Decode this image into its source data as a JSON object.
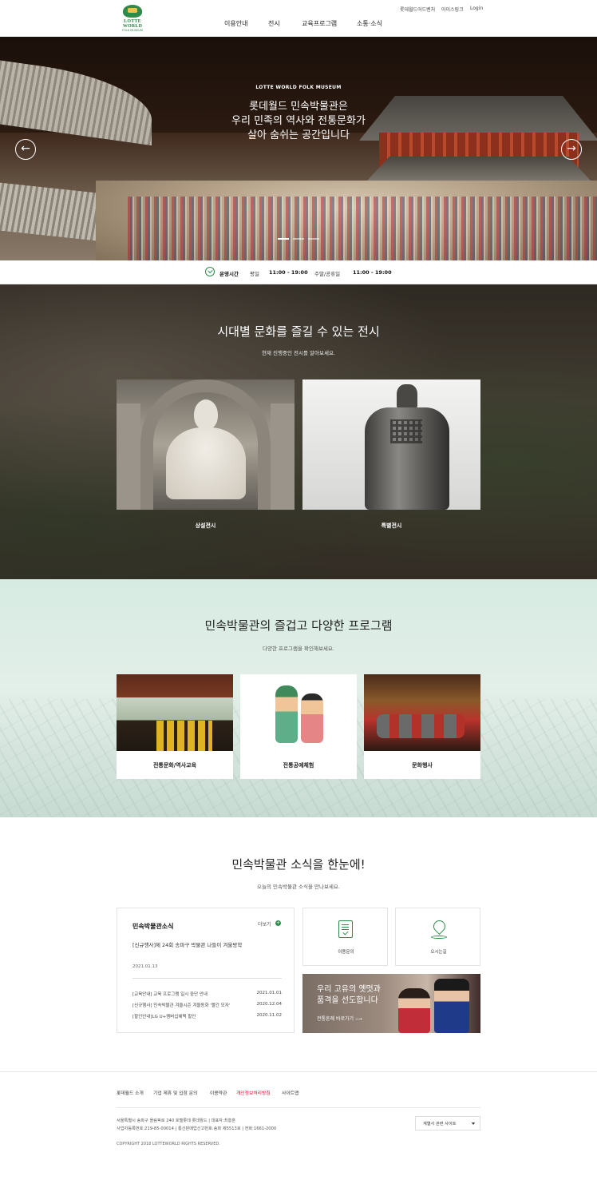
{
  "header": {
    "logo_text": "LOTTE WORLD",
    "logo_sub": "FOLK MUSEUM",
    "nav": [
      "이용안내",
      "전시",
      "교육프로그램",
      "소통·소식"
    ],
    "util": [
      "롯데월드어드벤처",
      "아이스링크",
      "Login"
    ]
  },
  "hero": {
    "tagline": "LOTTE WORLD FOLK MUSEUM",
    "title_lines": [
      "롯데월드 민속박물관은",
      "우리 민족의 역사와 전통문화가",
      "살아 숨쉬는 공간입니다"
    ],
    "prev_icon": "arrow-left-icon",
    "next_icon": "arrow-right-icon",
    "prev_glyph": "←",
    "next_glyph": "→"
  },
  "hours": {
    "label": "운영시간",
    "weekday_label": "평일",
    "weekday_time": "11:00 - 19:00",
    "weekend_label": "주말/공휴일",
    "weekend_time": "11:00 - 19:00"
  },
  "exhibition": {
    "title": "시대별 문화를 즐길 수 있는 전시",
    "subtitle": "현재 진행중인 전시를 알아보세요.",
    "cards": [
      {
        "label": "상설전시"
      },
      {
        "label": "특별전시"
      }
    ]
  },
  "programs": {
    "title": "민속박물관의 즐겁고 다양한 프로그램",
    "subtitle": "다양한 프로그램을 확인해보세요.",
    "cards": [
      {
        "label": "전통문화/역사교육"
      },
      {
        "label": "전통공예체험"
      },
      {
        "label": "문화행사"
      }
    ]
  },
  "news": {
    "title": "민속박물관 소식을 한눈에!",
    "subtitle": "오늘의 민속박물관 소식을 만나보세요.",
    "box_title": "민속박물관소식",
    "more_label": "더보기",
    "more_glyph": "+",
    "featured_title": "[신규행사]제 24회 송파구 박물관 나들이 겨울방학",
    "featured_date": "2021.01.13",
    "rows": [
      {
        "title": "[교육안내] 교육 프로그램 일시 중단 안내",
        "date": "2021.01.01"
      },
      {
        "title": "[신규행사] 민속박물관 겨울시즌 겨울동화 '빨간 모자'",
        "date": "2020.12.04"
      },
      {
        "title": "[할인안내]LG U+멤버십혜택 할인",
        "date": "2020.11.02"
      }
    ],
    "quick": [
      {
        "label": "이용문의",
        "icon": "document-check-icon"
      },
      {
        "label": "오시는길",
        "icon": "location-pin-icon"
      }
    ],
    "banner": {
      "lines": [
        "우리 고유의 옛멋과",
        "품격을 선도합니다"
      ],
      "cta": "전통혼례 바로가기 ⟶"
    }
  },
  "footer": {
    "links": [
      "롯데월드 소개",
      "기업 제휴 및 입점 문의",
      "이용약관",
      "개인정보처리방침",
      "사이트맵"
    ],
    "address_line1": "서울특별시 송파구 올림픽로 240 호텔롯데 롯데월드  |  대표자:최홍훈",
    "address_line2": "사업자등록번호:219-85-00014  |  통신판매업신고번호:송파 제5513호  |  전화:1661-2000",
    "copyright": "COPYRIGHT 2018 LOTTEWORLD RIGHTS RESERVED.",
    "family_site": "계열사 관련 사이트"
  },
  "colors": {
    "brand_green": "#2e8b4a",
    "privacy_link": "#e4002b",
    "program_bg": "#d6ebe2"
  }
}
